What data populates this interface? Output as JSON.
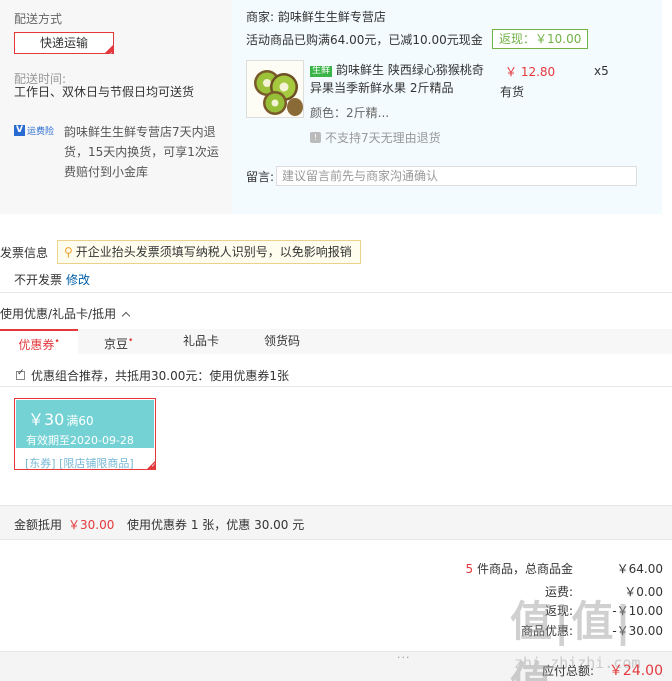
{
  "shipping": {
    "title": "配送方式",
    "method_button": "快递运输",
    "time_label": "配送时间:",
    "time_value": "工作日、双休日与节假日均可送货"
  },
  "insurance": {
    "badge_letter": "V",
    "badge_text": "运费险",
    "description": "韵味鲜生生鲜专营店7天内退货，15天内换货，可享1次运费赔付到小金库"
  },
  "merchant": {
    "label": "商家:",
    "name": "韵味鲜生生鲜专营店",
    "promo_text": "活动商品已购满64.00元，已减10.00元现金",
    "cashback": "返现：￥10.00"
  },
  "product": {
    "tag": "生鲜",
    "name": "韵味鲜生 陕西绿心猕猴桃奇异果当季新鲜水果 2斤精品",
    "price": "￥ 12.80",
    "qty": "x5",
    "stock": "有货",
    "color": "颜色：2斤精...",
    "return_policy": "不支持7天无理由退货",
    "image_icon": "kiwi-fruit-image"
  },
  "message": {
    "label": "留言:",
    "placeholder": "建议留言前先与商家沟通确认"
  },
  "invoice": {
    "title": "发票信息",
    "tip": "开企业抬头发票须填写纳税人识别号，以免影响报销",
    "value": "不开发票",
    "edit": "修改"
  },
  "coupons": {
    "title": "使用优惠/礼品卡/抵用",
    "tabs": [
      {
        "label": "优惠券",
        "star": "•"
      },
      {
        "label": "京豆",
        "star": "•"
      },
      {
        "label": "礼品卡",
        "star": ""
      },
      {
        "label": "领货码",
        "star": ""
      }
    ],
    "combo_text": "优惠组合推荐，共抵用30.00元：使用优惠券1张",
    "card": {
      "amount": "￥30",
      "condition": "满60",
      "expiry": "有效期至2020-09-28",
      "tags": "[东券] [限店铺限商品]"
    },
    "summary_label": "金额抵用",
    "summary_amount": "￥30.00",
    "summary_desc": "使用优惠券 1 张，优惠 30.00 元"
  },
  "totals": {
    "count": "5",
    "count_suffix": " 件商品，总商品金",
    "goods_value": "￥64.00",
    "freight_label": "运费:",
    "freight_value": "￥0.00",
    "row3_label": "返现:",
    "row3_value": "-￥10.00",
    "row4_label": "商品优惠:",
    "row4_value": "-￥30.00",
    "payable_label": "应付总额:",
    "payable_value": "￥24.00",
    "dots": "..."
  },
  "watermark": {
    "big": "值|值|值",
    "small": "zhi.zhizhi.com"
  },
  "colors": {
    "accent": "#e4393c",
    "link": "#005ea7",
    "coupon": "#74d2d4",
    "cashback_green": "#71b247"
  }
}
